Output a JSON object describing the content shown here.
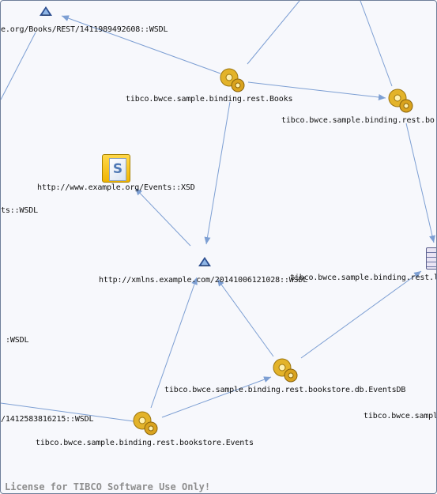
{
  "nodes": {
    "books_rest_wsdl": {
      "label": "e.org/Books/REST/1411989492608::WSDL",
      "icon": "wsdl-triangle-icon"
    },
    "binding_books": {
      "label": "tibco.bwce.sample.binding.rest.Books",
      "icon": "process-gears-icon"
    },
    "binding_rest_bo": {
      "label": "tibco.bwce.sample.binding.rest.bo",
      "icon": "process-gears-icon"
    },
    "events_xsd": {
      "label": "http://www.example.org/Events::XSD",
      "icon": "xsd-document-icon"
    },
    "ts_wsdl": {
      "label": "ts::WSDL",
      "icon": "wsdl-icon"
    },
    "xmlns_wsdl": {
      "label": "http://xmlns.example.com/20141006121028::WSDL",
      "icon": "wsdl-triangle-icon"
    },
    "binding_rest_l": {
      "label": "tibco.bwce.sample.binding.rest.l",
      "icon": "database-icon"
    },
    "left_wsdl": {
      "label": ":WSDL",
      "icon": "wsdl-icon"
    },
    "binding_eventsdb": {
      "label": "tibco.bwce.sample.binding.rest.bookstore.db.EventsDB",
      "icon": "process-gears-icon"
    },
    "binding_sampl": {
      "label": "tibco.bwce.sampl",
      "icon": "process-icon"
    },
    "wsdl_1412583816215": {
      "label": "/1412583816215::WSDL",
      "icon": "wsdl-icon"
    },
    "binding_events": {
      "label": "tibco.bwce.sample.binding.rest.bookstore.Events",
      "icon": "process-gears-icon"
    }
  },
  "license": "License for TIBCO Software Use Only!",
  "colors": {
    "edge": "#7d9fd3",
    "background": "#f7f8fc",
    "license": "#8e8e8e"
  }
}
